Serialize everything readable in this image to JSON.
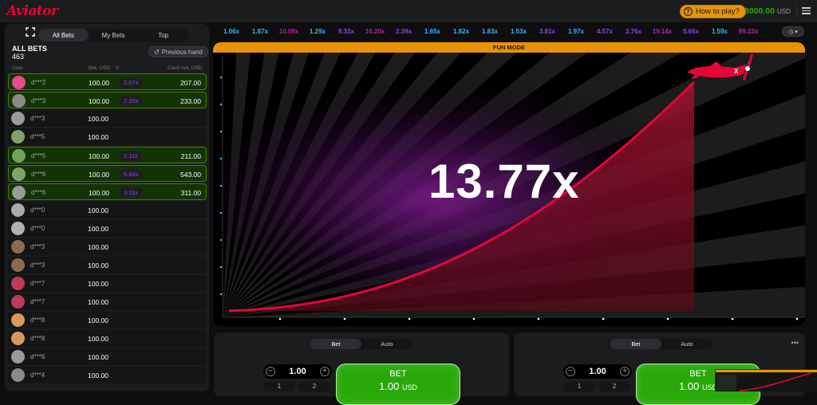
{
  "app": {
    "logo": "Aviator"
  },
  "topbar": {
    "how_to_play": "How to play?",
    "balance": "3000.00",
    "currency": "USD"
  },
  "left_panel": {
    "tabs": [
      {
        "label": "All Bets",
        "active": true
      },
      {
        "label": "My Bets",
        "active": false
      },
      {
        "label": "Top",
        "active": false
      }
    ],
    "all_bets_label": "ALL BETS",
    "bets_count": "463",
    "previous_hand": "Previous hand",
    "columns": {
      "user": "User",
      "bet": "Bet, USD",
      "x": "X",
      "cashout": "Cash out, USD"
    },
    "rows": [
      {
        "user": "d***2",
        "bet": "100.00",
        "mult": "2.07x",
        "cashout": "207.00",
        "win": true,
        "avatar": "#e74c8a"
      },
      {
        "user": "d***3",
        "bet": "100.00",
        "mult": "2.33x",
        "cashout": "233.00",
        "win": true,
        "avatar": "#8a8a8a"
      },
      {
        "user": "d***3",
        "bet": "100.00",
        "mult": "",
        "cashout": "",
        "win": false,
        "avatar": "#9a9a9a"
      },
      {
        "user": "d***5",
        "bet": "100.00",
        "mult": "",
        "cashout": "",
        "win": false,
        "avatar": "#7fa36b"
      },
      {
        "user": "d***5",
        "bet": "100.00",
        "mult": "2.11x",
        "cashout": "211.00",
        "win": true,
        "avatar": "#6ea55a"
      },
      {
        "user": "d***6",
        "bet": "100.00",
        "mult": "5.43x",
        "cashout": "543.00",
        "win": true,
        "avatar": "#7fa36b"
      },
      {
        "user": "d***6",
        "bet": "100.00",
        "mult": "3.11x",
        "cashout": "311.00",
        "win": true,
        "avatar": "#9a9a9a"
      },
      {
        "user": "d***0",
        "bet": "100.00",
        "mult": "",
        "cashout": "",
        "win": false,
        "avatar": "#aaaaaa"
      },
      {
        "user": "d***0",
        "bet": "100.00",
        "mult": "",
        "cashout": "",
        "win": false,
        "avatar": "#b0b0b0"
      },
      {
        "user": "d***3",
        "bet": "100.00",
        "mult": "",
        "cashout": "",
        "win": false,
        "avatar": "#8c6a4f"
      },
      {
        "user": "d***3",
        "bet": "100.00",
        "mult": "",
        "cashout": "",
        "win": false,
        "avatar": "#8c6a4f"
      },
      {
        "user": "d***7",
        "bet": "100.00",
        "mult": "",
        "cashout": "",
        "win": false,
        "avatar": "#c0395a"
      },
      {
        "user": "d***7",
        "bet": "100.00",
        "mult": "",
        "cashout": "",
        "win": false,
        "avatar": "#c0395a"
      },
      {
        "user": "d***8",
        "bet": "100.00",
        "mult": "",
        "cashout": "",
        "win": false,
        "avatar": "#d89a5a"
      },
      {
        "user": "d***8",
        "bet": "100.00",
        "mult": "",
        "cashout": "",
        "win": false,
        "avatar": "#d89a5a"
      },
      {
        "user": "d***6",
        "bet": "100.00",
        "mult": "",
        "cashout": "",
        "win": false,
        "avatar": "#9a9a9a"
      },
      {
        "user": "d***4",
        "bet": "100.00",
        "mult": "",
        "cashout": "",
        "win": false,
        "avatar": "#8a8a8a"
      }
    ]
  },
  "history": [
    {
      "v": "1.06x",
      "c": "#34b4ff"
    },
    {
      "v": "1.87x",
      "c": "#34b4ff"
    },
    {
      "v": "10.09x",
      "c": "#c017b4"
    },
    {
      "v": "1.29x",
      "c": "#34b4ff"
    },
    {
      "v": "9.32x",
      "c": "#913ef8"
    },
    {
      "v": "10.20x",
      "c": "#c017b4"
    },
    {
      "v": "2.39x",
      "c": "#913ef8"
    },
    {
      "v": "1.65x",
      "c": "#34b4ff"
    },
    {
      "v": "1.82x",
      "c": "#34b4ff"
    },
    {
      "v": "1.83x",
      "c": "#34b4ff"
    },
    {
      "v": "1.53x",
      "c": "#34b4ff"
    },
    {
      "v": "3.81x",
      "c": "#913ef8"
    },
    {
      "v": "1.97x",
      "c": "#34b4ff"
    },
    {
      "v": "4.57x",
      "c": "#913ef8"
    },
    {
      "v": "2.76x",
      "c": "#913ef8"
    },
    {
      "v": "19.14x",
      "c": "#c017b4"
    },
    {
      "v": "5.66x",
      "c": "#913ef8"
    },
    {
      "v": "1.59x",
      "c": "#34b4ff"
    },
    {
      "v": "99.22x",
      "c": "#c017b4"
    }
  ],
  "stage": {
    "fun_mode": "FUN MODE",
    "multiplier": "13.77x"
  },
  "bet_panels": [
    {
      "tabs": [
        "Bet",
        "Auto"
      ],
      "amount": "1.00",
      "quick": [
        "1",
        "2"
      ],
      "button_label": "BET",
      "button_amount": "1.00",
      "button_currency": "USD"
    },
    {
      "tabs": [
        "Bet",
        "Auto"
      ],
      "amount": "1.00",
      "quick": [
        "1",
        "2"
      ],
      "button_label": "BET",
      "button_amount": "1.00",
      "button_currency": "USD"
    }
  ]
}
